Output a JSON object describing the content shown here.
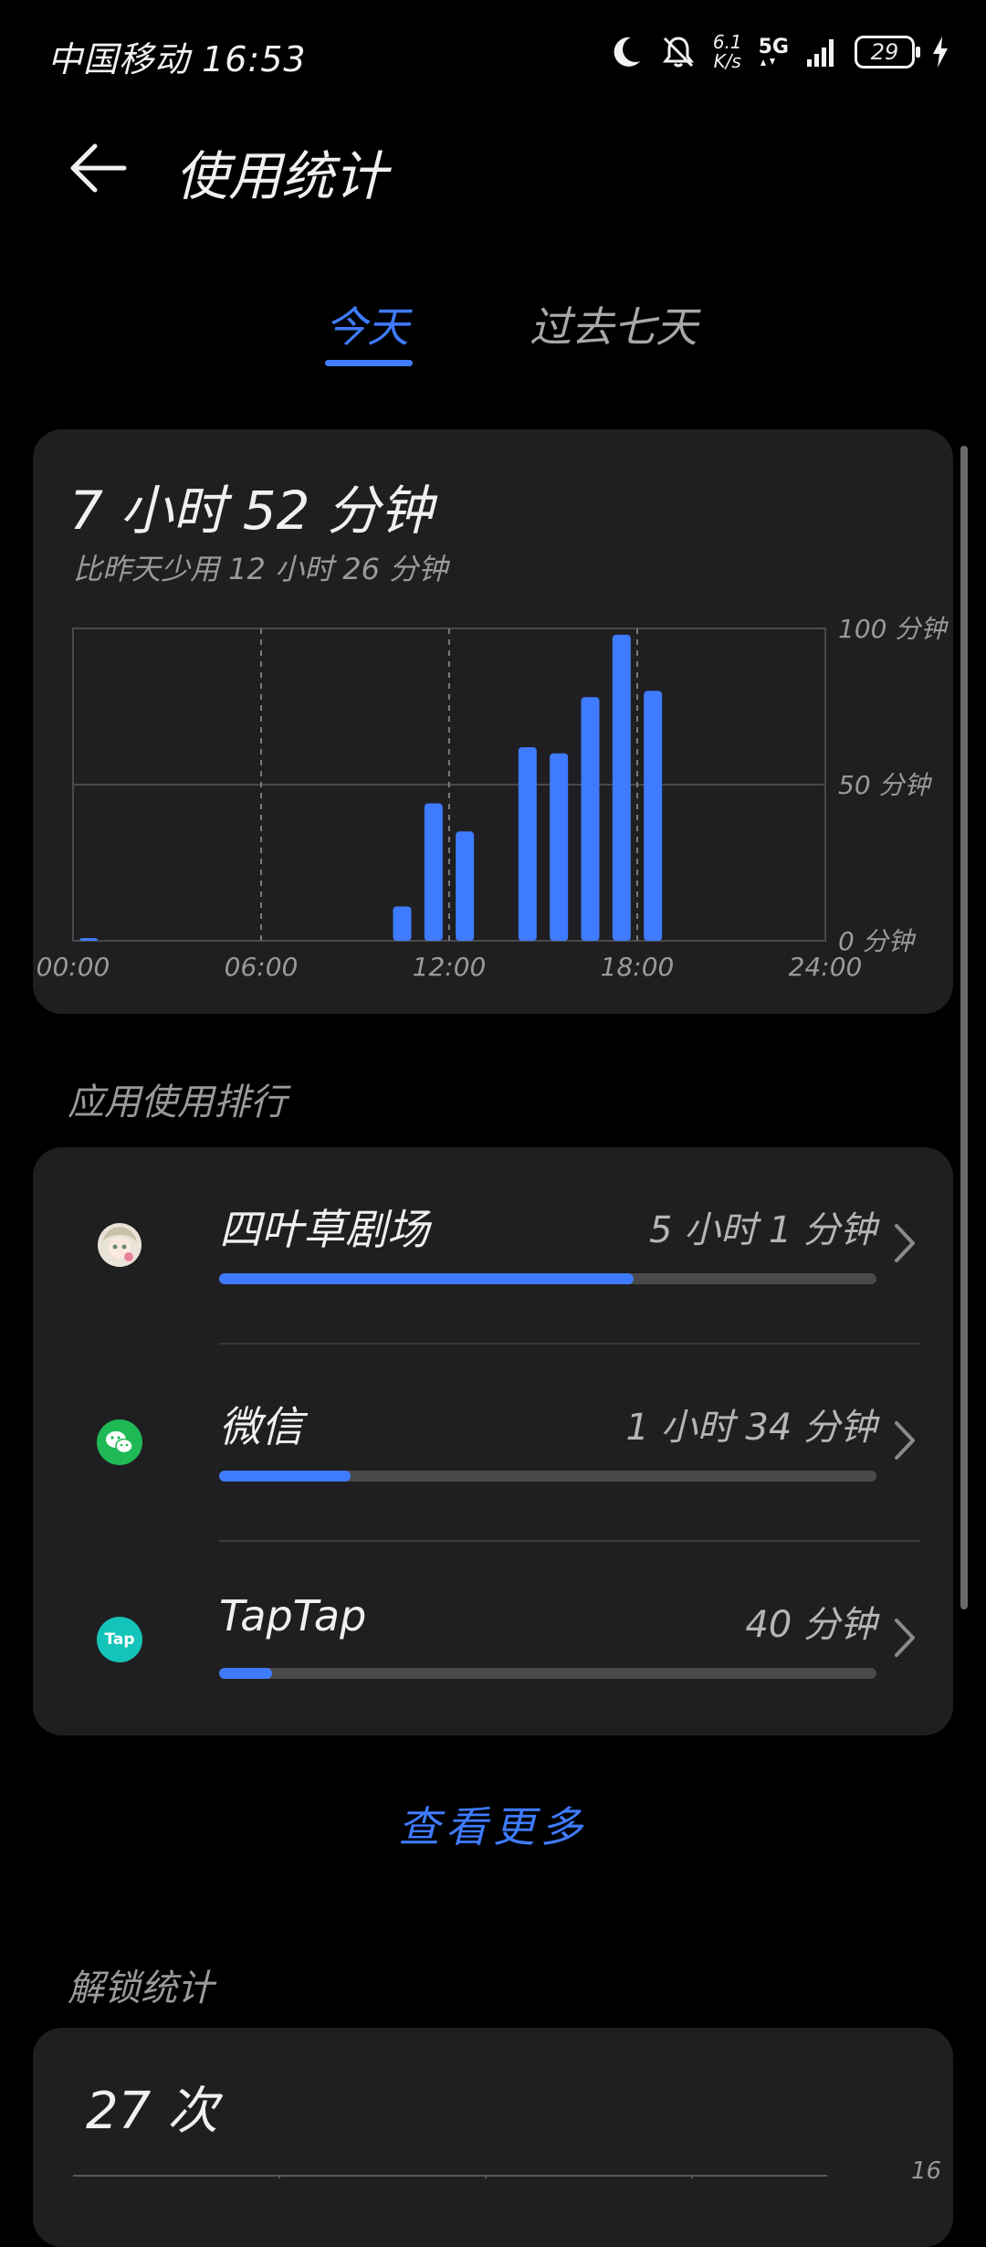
{
  "status_bar": {
    "carrier_time": "中国移动 16:53",
    "net_speed_value": "6.1",
    "net_speed_unit": "K/s",
    "signal_label": "5G",
    "battery_level": "29"
  },
  "header": {
    "title": "使用统计"
  },
  "tabs": [
    {
      "label": "今天",
      "active": true
    },
    {
      "label": "过去七天",
      "active": false
    }
  ],
  "usage": {
    "total": "7 小时 52 分钟",
    "compare": "比昨天少用 12 小时 26 分钟"
  },
  "chart_data": {
    "type": "bar",
    "x": [
      "00:00",
      "01:00",
      "02:00",
      "03:00",
      "04:00",
      "05:00",
      "06:00",
      "07:00",
      "08:00",
      "09:00",
      "10:00",
      "11:00",
      "12:00",
      "13:00",
      "14:00",
      "15:00",
      "16:00",
      "17:00",
      "18:00",
      "19:00",
      "20:00",
      "21:00",
      "22:00",
      "23:00"
    ],
    "values": [
      0.5,
      0,
      0,
      0,
      0,
      0,
      0,
      0,
      0,
      0,
      11,
      44,
      35,
      0,
      62,
      60,
      78,
      98,
      80,
      0,
      0,
      0,
      0,
      0
    ],
    "x_tick_labels": [
      "00:00",
      "06:00",
      "12:00",
      "18:00",
      "24:00"
    ],
    "y_tick_labels": [
      "0 分钟",
      "50 分钟",
      "100 分钟"
    ],
    "ylim": [
      0,
      100
    ],
    "bar_color": "#3f7bff",
    "grid": true
  },
  "ranking": {
    "heading": "应用使用排行",
    "apps": [
      {
        "name": "四叶草剧场",
        "time": "5 小时 1 分钟",
        "fraction": 0.63,
        "icon": "anime-avatar-icon"
      },
      {
        "name": "微信",
        "time": "1 小时 34 分钟",
        "fraction": 0.2,
        "icon": "wechat-icon"
      },
      {
        "name": "TapTap",
        "time": "40 分钟",
        "fraction": 0.08,
        "icon": "taptap-icon",
        "icon_text": "Tap"
      }
    ]
  },
  "view_more": "查看更多",
  "unlock": {
    "heading": "解锁统计",
    "count": "27 次",
    "axis_top": "16"
  },
  "colors": {
    "accent": "#3f7bff",
    "card": "#1f1f21",
    "background": "#000000",
    "wechat_green": "#1fb955",
    "taptap_teal": "#14c4b8"
  }
}
